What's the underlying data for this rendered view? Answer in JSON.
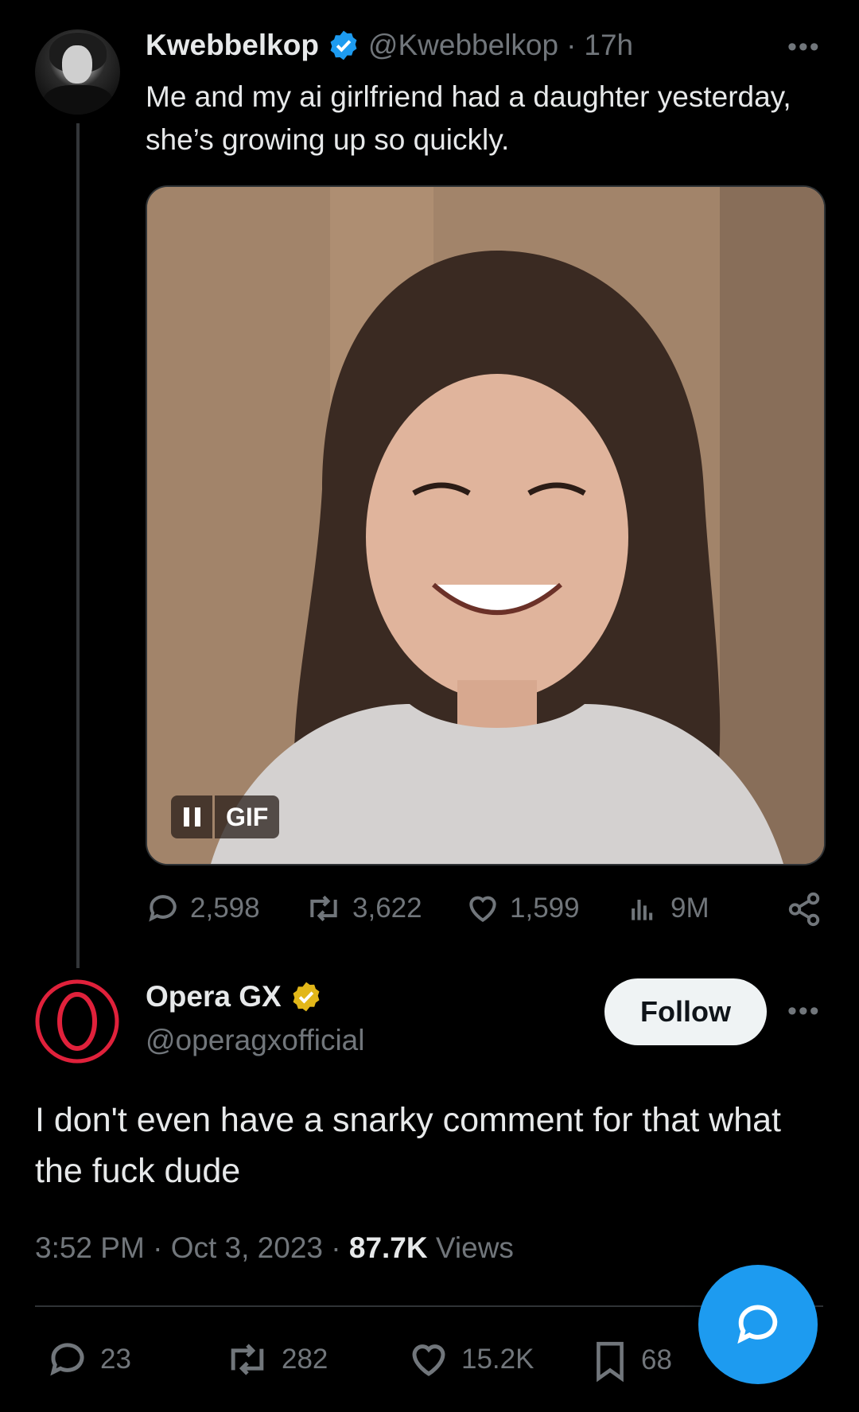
{
  "parent_tweet": {
    "display_name": "Kwebbelkop",
    "verified_badge": "blue-check-icon",
    "handle": "@Kwebbelkop",
    "time_separator": "·",
    "time": "17h",
    "text": "Me and my ai girlfriend had a daughter yesterday, she’s growing up so quickly.",
    "media": {
      "type": "gif",
      "gif_label": "GIF",
      "pause_icon": "pause-icon"
    },
    "actions": {
      "replies": "2,598",
      "retweets": "3,622",
      "likes": "1,599",
      "views": "9M"
    },
    "more_icon": "more-horizontal-icon"
  },
  "reply_tweet": {
    "display_name": "Opera GX",
    "verified_badge": "gold-check-icon",
    "handle": "@operagxofficial",
    "follow_label": "Follow",
    "text": "I don't even have a snarky comment for that what the fuck dude",
    "meta": {
      "time": "3:52 PM",
      "sep1": "·",
      "date": "Oct 3, 2023",
      "sep2": "·",
      "views_count": "87.7K",
      "views_label": "Views"
    },
    "actions": {
      "replies": "23",
      "retweets": "282",
      "likes": "15.2K",
      "bookmarks": "68"
    }
  },
  "fab_icon": "reply-compose-icon",
  "colors": {
    "background": "#000000",
    "text_primary": "#e7e9ea",
    "text_secondary": "#71767b",
    "accent_blue": "#1d9bf0",
    "gold_verified": "#e2b719",
    "opera_red": "#e0213b"
  }
}
